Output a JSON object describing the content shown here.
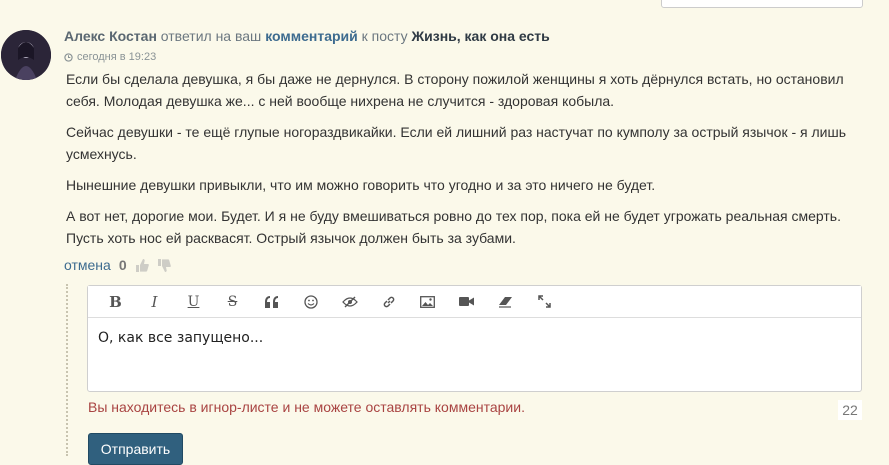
{
  "notification": {
    "author": "Алекс Костан",
    "action_text": " ответил на ваш ",
    "comment_link": "комментарий",
    "post_prefix": " к посту ",
    "post_title": "Жизнь, как она есть",
    "timestamp": "сегодня в 19:23"
  },
  "comment": {
    "paragraphs": [
      "Если бы сделала девушка, я бы даже не дернулся. В сторону пожилой женщины я хоть дёрнулся встать, но остановил себя. Молодая девушка же... с ней вообще нихрена не случится - здоровая кобыла.",
      "Сейчас девушки - те ещё глупые ногораздвикайки. Если ей лишний раз настучат по кумполу за острый язычок - я лишь усмехнусь.",
      "Нынешние девушки привыкли, что им можно говорить что угодно и за это ничего не будет.",
      "А вот нет, дорогие мои. Будет. И я не буду вмешиваться ровно до тех пор, пока ей не будет угрожать реальная смерть. Пусть хоть нос ей расквасят. Острый язычок должен быть за зубами."
    ],
    "cancel_label": "отмена",
    "rating": "0"
  },
  "editor": {
    "toolbar_icons": [
      "bold-icon",
      "italic-icon",
      "underline-icon",
      "strikethrough-icon",
      "quote-icon",
      "smile-icon",
      "spoiler-icon",
      "link-icon",
      "image-icon",
      "video-icon",
      "eraser-icon",
      "fullscreen-icon"
    ],
    "text": "О, как все запущено...",
    "error_message": "Вы находитесь в игнор-листе и не можете оставлять комментарии.",
    "char_count": "22",
    "submit_label": "Отправить"
  }
}
